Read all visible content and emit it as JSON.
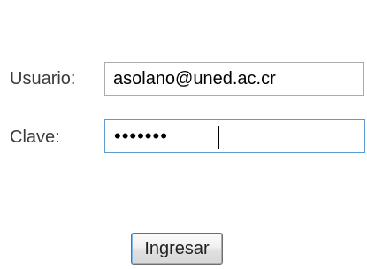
{
  "login": {
    "user_label": "Usuario:",
    "user_value": "asolano@uned.ac.cr",
    "pass_label": "Clave:",
    "pass_masked": "•••••••",
    "submit_label": "Ingresar"
  }
}
